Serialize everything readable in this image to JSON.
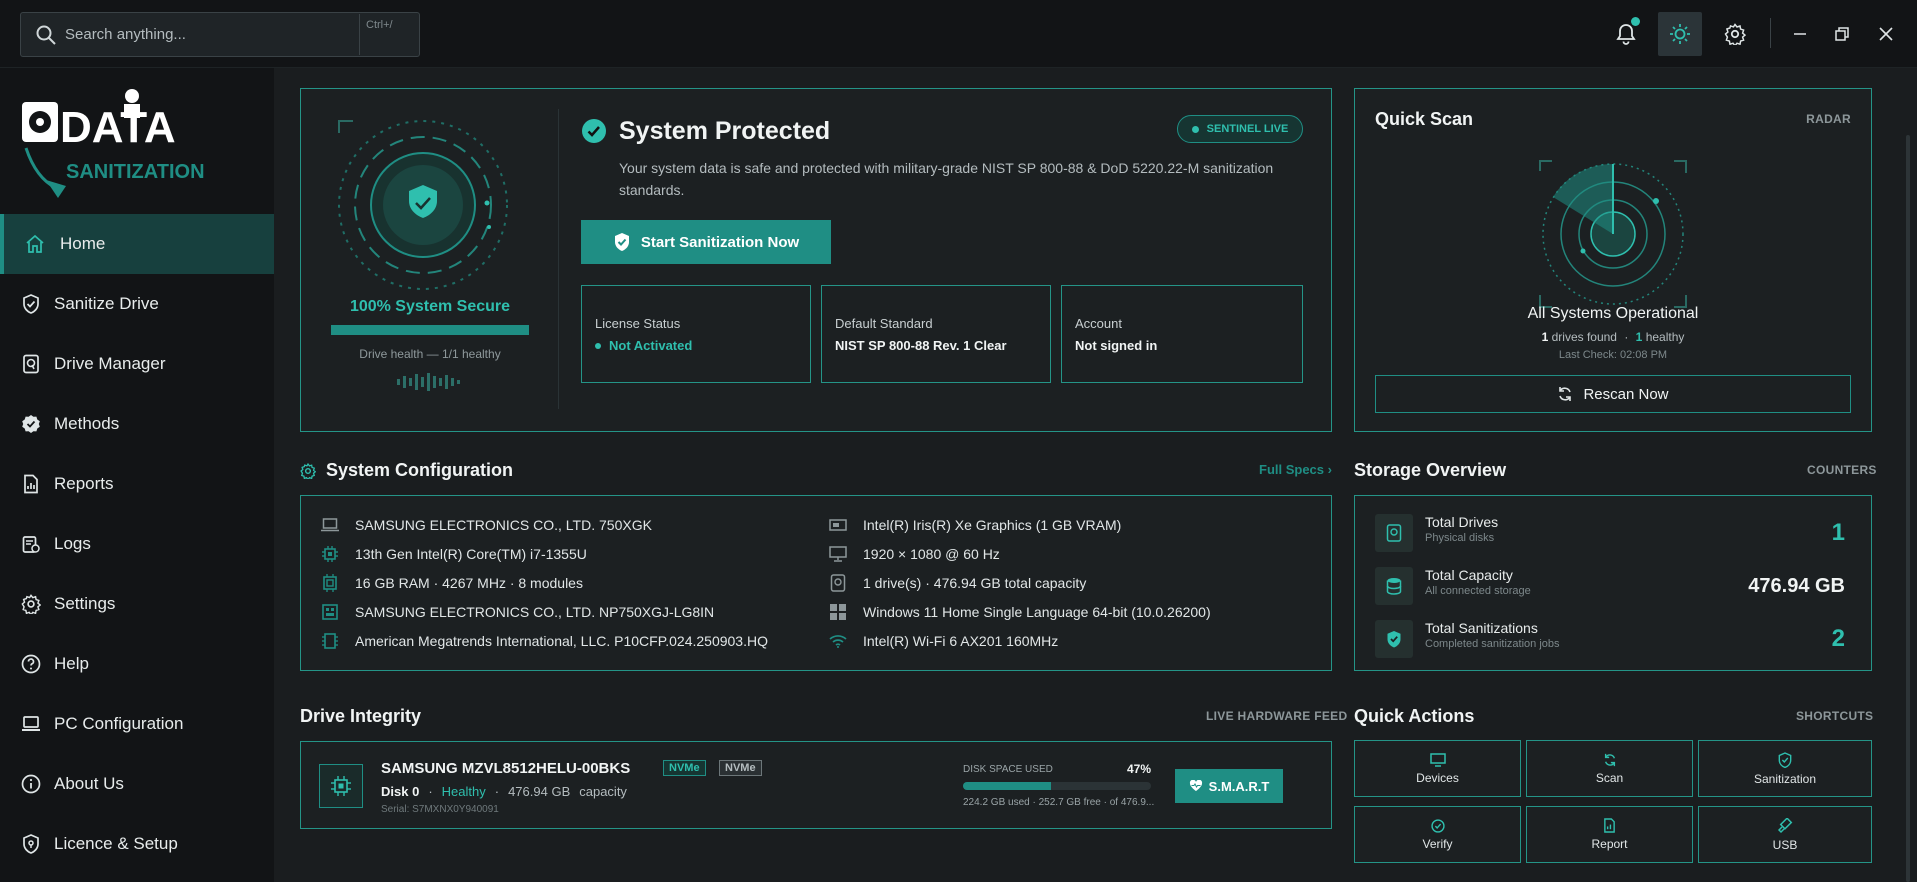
{
  "topbar": {
    "search_placeholder": "Search anything...",
    "search_shortcut": "Ctrl+/"
  },
  "sidebar": {
    "logo_text": [
      "DATA",
      "SANITIZATION"
    ],
    "items": [
      {
        "label": "Home",
        "icon": "home-icon",
        "active": true
      },
      {
        "label": "Sanitize Drive",
        "icon": "shield-icon"
      },
      {
        "label": "Drive Manager",
        "icon": "drive-icon"
      },
      {
        "label": "Methods",
        "icon": "badge-check-icon"
      },
      {
        "label": "Reports",
        "icon": "report-icon"
      },
      {
        "label": "Logs",
        "icon": "logs-icon"
      },
      {
        "label": "Settings",
        "icon": "gear-icon"
      },
      {
        "label": "Help",
        "icon": "help-icon"
      },
      {
        "label": "PC Configuration",
        "icon": "laptop-icon"
      },
      {
        "label": "About Us",
        "icon": "info-icon"
      },
      {
        "label": "Licence & Setup",
        "icon": "license-icon"
      }
    ]
  },
  "hero": {
    "secure_label": "100% System Secure",
    "secure_progress": 1.0,
    "drive_health": "Drive health — 1/1 healthy",
    "title": "System Protected",
    "badge": "SENTINEL LIVE",
    "description": "Your system data is safe and protected with military-grade NIST SP 800-88 & DoD 5220.22-M sanitization standards.",
    "cta": "Start Sanitization Now",
    "license_label": "License Status",
    "license_value": "Not Activated",
    "standard_label": "Default Standard",
    "standard_value": "NIST SP 800-88 Rev. 1 Clear",
    "account_label": "Account",
    "account_value": "Not signed in"
  },
  "quick_scan": {
    "title": "Quick Scan",
    "kicker": "RADAR",
    "status": "All Systems Operational",
    "drives_found_count": "1",
    "drives_found_label": "drives found",
    "healthy_count": "1",
    "healthy_label": "healthy",
    "last_check": "Last Check: 02:08 PM",
    "rescan": "Rescan Now"
  },
  "system_config": {
    "title": "System Configuration",
    "link": "Full Specs ›",
    "left": [
      "SAMSUNG ELECTRONICS CO., LTD. 750XGK",
      "13th Gen Intel(R) Core(TM) i7-1355U",
      "16 GB RAM · 4267 MHz · 8 modules",
      "SAMSUNG ELECTRONICS CO., LTD. NP750XGJ-LG8IN",
      "American Megatrends International, LLC. P10CFP.024.250903.HQ"
    ],
    "right": [
      "Intel(R) Iris(R) Xe Graphics (1 GB VRAM)",
      "1920 × 1080 @ 60 Hz",
      "1 drive(s) · 476.94 GB total capacity",
      "Windows 11 Home Single Language 64-bit (10.0.26200)",
      "Intel(R) Wi-Fi 6 AX201 160MHz"
    ]
  },
  "storage": {
    "title": "Storage Overview",
    "kicker": "COUNTERS",
    "rows": [
      {
        "title": "Total Drives",
        "sub": "Physical disks",
        "value": "1"
      },
      {
        "title": "Total Capacity",
        "sub": "All connected storage",
        "value": "476.94 GB"
      },
      {
        "title": "Total Sanitizations",
        "sub": "Completed sanitization jobs",
        "value": "2"
      }
    ]
  },
  "drive_integrity": {
    "title": "Drive Integrity",
    "kicker": "LIVE HARDWARE FEED",
    "model": "SAMSUNG MZVL8512HELU-00BKS",
    "tag1": "NVMe",
    "tag2": "NVMe",
    "disk": "Disk 0",
    "health": "Healthy",
    "size": "476.94 GB",
    "size_label": "capacity",
    "serial": "Serial: S7MXNX0Y940091",
    "space_label": "DISK SPACE USED",
    "space_pct": "47%",
    "space_fraction": 0.47,
    "space_detail": "224.2 GB used · 252.7 GB free · of 476.9...",
    "smart_btn": "S.M.A.R.T"
  },
  "quick_actions": {
    "title": "Quick Actions",
    "kicker": "SHORTCUTS",
    "items": [
      "Devices",
      "Scan",
      "Sanitization",
      "Verify",
      "Report",
      "USB"
    ]
  },
  "colors": {
    "accent": "#1f8e84",
    "accent_bright": "#2fbfae",
    "panel_border": "#249487"
  }
}
